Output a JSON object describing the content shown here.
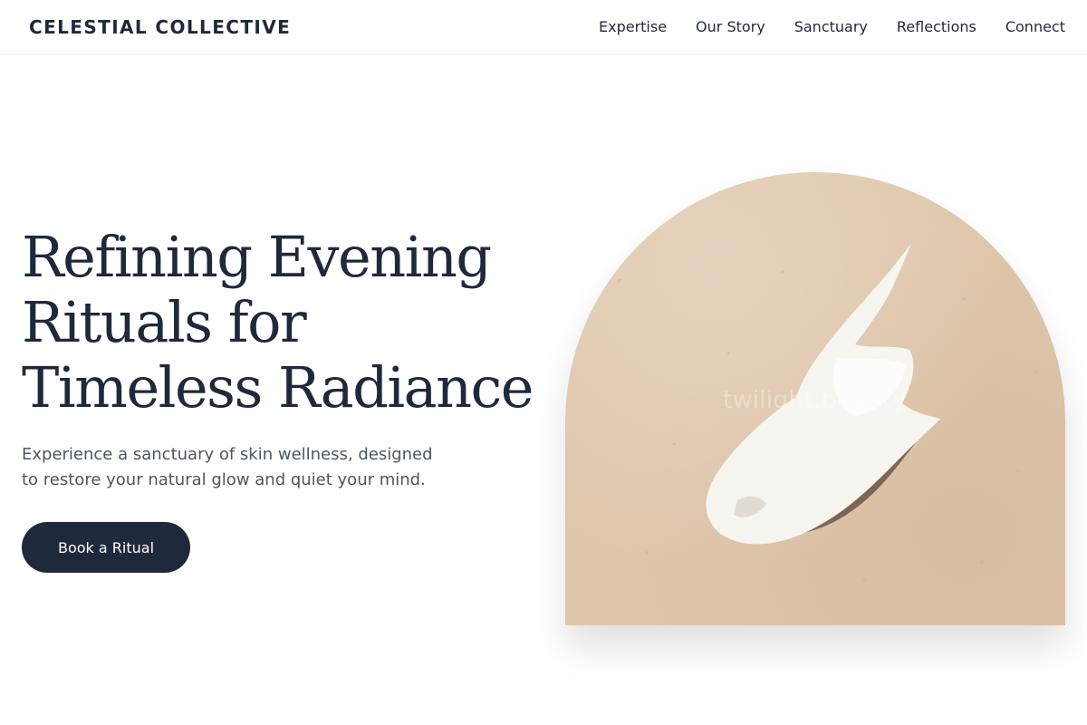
{
  "header": {
    "logo": "CELESTIAL COLLECTIVE",
    "nav": [
      {
        "label": "Expertise"
      },
      {
        "label": "Our Story"
      },
      {
        "label": "Sanctuary"
      },
      {
        "label": "Reflections"
      },
      {
        "label": "Connect"
      }
    ]
  },
  "hero": {
    "title_lines": [
      "Refining Evening",
      "Rituals for",
      "Timeless Radiance"
    ],
    "subtitle_lines": [
      "Experience a sanctuary of skin wellness, designed",
      "to restore your natural glow and quiet your mind."
    ],
    "cta_label": "Book a Ritual",
    "image": {
      "watermark": "twilight.beauty"
    }
  },
  "colors": {
    "primary": "#1e293b",
    "text_muted": "#4b5563",
    "image_background": "#dfc6ab",
    "cream": "#f7f5ef"
  }
}
